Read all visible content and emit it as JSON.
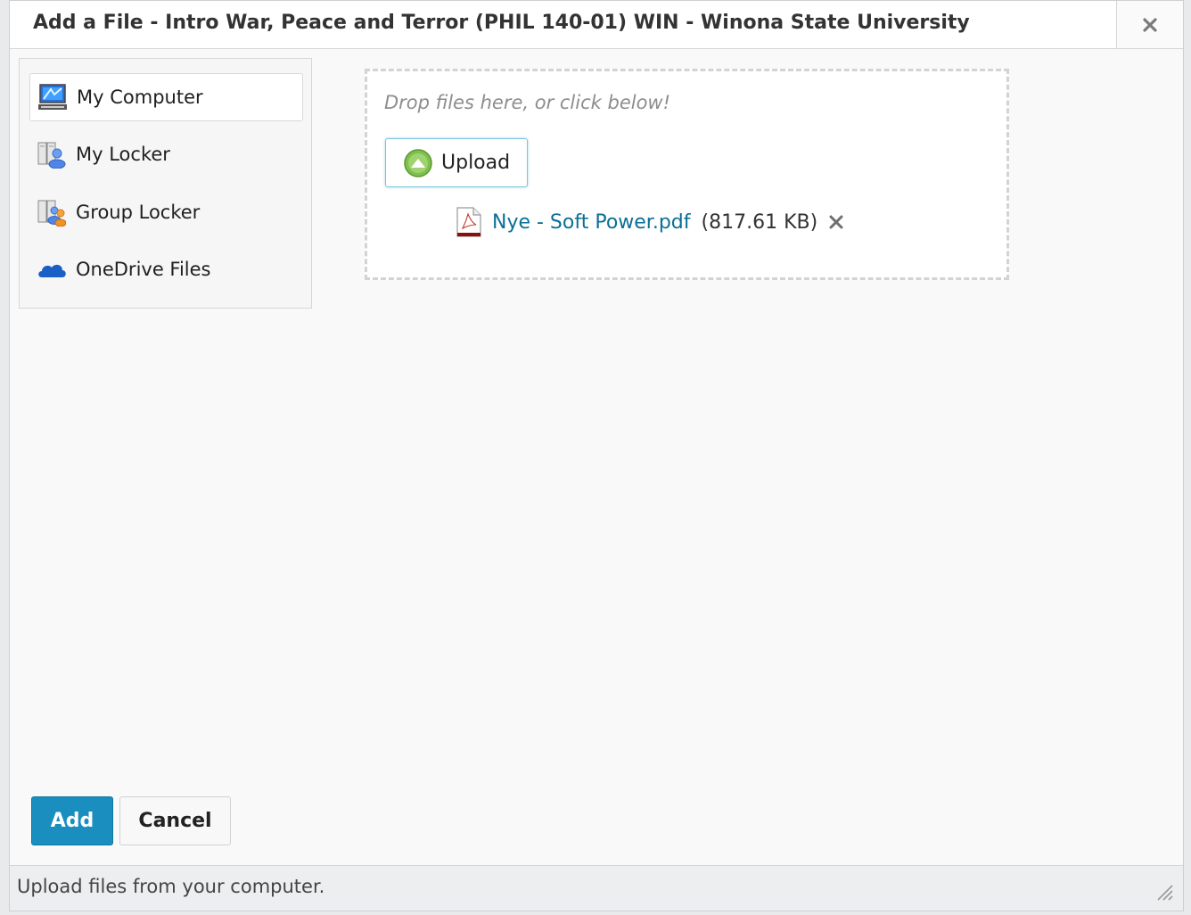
{
  "dialog": {
    "title": "Add a File - Intro War, Peace and Terror (PHIL 140-01) WIN - Winona State University",
    "close_icon": "close-icon"
  },
  "sidebar": {
    "items": [
      {
        "label": "My Computer",
        "icon": "computer-icon",
        "selected": true
      },
      {
        "label": "My Locker",
        "icon": "locker-icon",
        "selected": false
      },
      {
        "label": "Group Locker",
        "icon": "group-locker-icon",
        "selected": false
      },
      {
        "label": "OneDrive Files",
        "icon": "onedrive-cloud-icon",
        "selected": false
      }
    ]
  },
  "dropzone": {
    "hint": "Drop files here, or click below!",
    "upload_label": "Upload",
    "file": {
      "name": "Nye - Soft Power.pdf",
      "size": "(817.61 KB)",
      "icon": "pdf-file-icon"
    }
  },
  "actions": {
    "add_label": "Add",
    "cancel_label": "Cancel",
    "add_color": "#1a8fbf"
  },
  "footer": {
    "status": "Upload files from your computer."
  }
}
